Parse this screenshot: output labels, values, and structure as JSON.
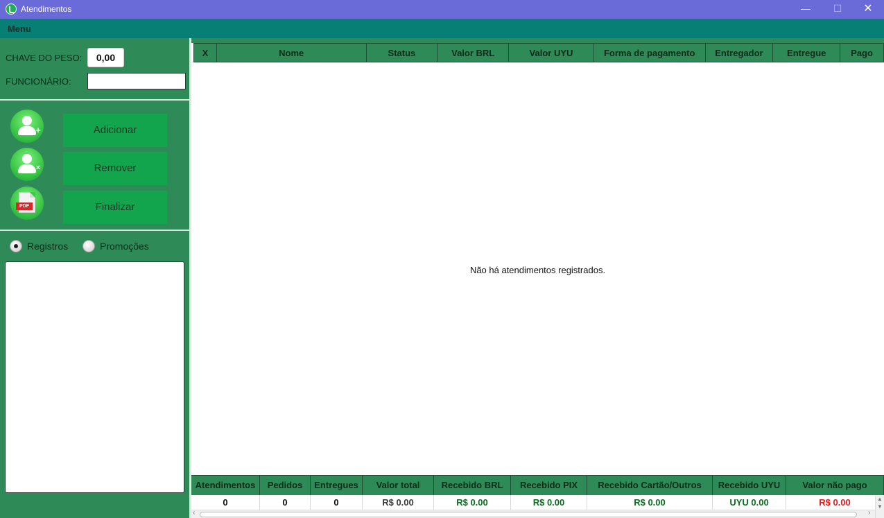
{
  "window": {
    "title": "Atendimentos",
    "controls": {
      "minimize": "—",
      "maximize": "☐",
      "close": "✕"
    }
  },
  "menubar": {
    "menu_label": "Menu"
  },
  "left_panel": {
    "peso_label": "CHAVE DO PESO:",
    "peso_value": "0,00",
    "funcionario_label": "FUNCIONÁRIO:",
    "funcionario_value": "",
    "buttons": {
      "add": "Adicionar",
      "remove": "Remover",
      "finalize": "Finalizar"
    },
    "icons": {
      "add": "add-user-icon",
      "remove": "remove-user-icon",
      "finalize": "pdf-icon",
      "pdf_tag": "PDF"
    },
    "radios": {
      "registros": "Registros",
      "promocoes": "Promoções",
      "selected": "registros"
    }
  },
  "table": {
    "columns": [
      "X",
      "Nome",
      "Status",
      "Valor BRL",
      "Valor UYU",
      "Forma de pagamento",
      "Entregador",
      "Entregue",
      "Pago"
    ],
    "rows": [],
    "empty_message": "Não há atendimentos registrados."
  },
  "summary": {
    "headers": [
      "Atendimentos",
      "Pedidos",
      "Entregues",
      "Valor total",
      "Recebido BRL",
      "Recebido PIX",
      "Recebido Cartão/Outros",
      "Recebido UYU",
      "Valor não pago"
    ],
    "values": [
      "0",
      "0",
      "0",
      "R$ 0.00",
      "R$ 0.00",
      "R$ 0.00",
      "R$ 0.00",
      "UYU 0.00",
      "R$ 0.00"
    ],
    "value_colors": [
      "#111111",
      "#111111",
      "#111111",
      "#3a3a3a",
      "#0a6e1e",
      "#0a6e1e",
      "#0a6e1e",
      "#0a6e1e",
      "#e01b1b"
    ]
  },
  "colors": {
    "titlebar": "#6a6bd8",
    "menubar": "#087f75",
    "panel": "#2e8b57",
    "button": "#13a54e"
  }
}
